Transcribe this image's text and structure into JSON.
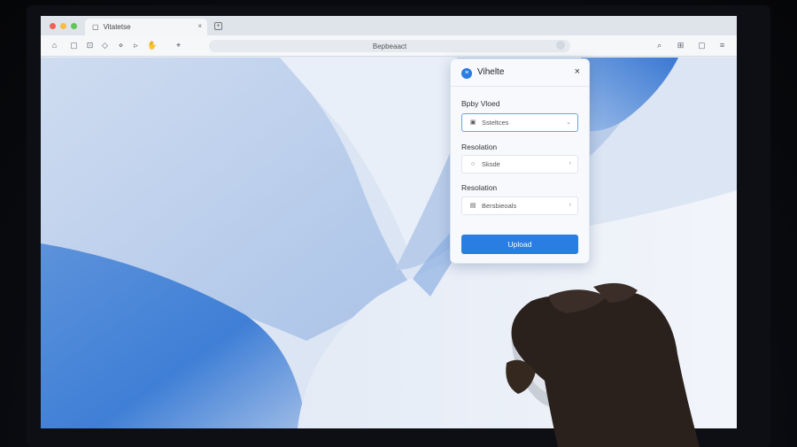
{
  "browser": {
    "tab_title": "Vitatetse",
    "tab_close": "×",
    "new_tab": "+",
    "address": "Bepbeaact",
    "address_icon": "Ǟ"
  },
  "toolbar_icons": [
    "home-icon",
    "page-icon",
    "bookmark-icon",
    "tag-icon",
    "sparkle-icon",
    "cursor-icon",
    "hand-icon",
    "pin-icon"
  ],
  "toolbar_right_icons": [
    "search-icon",
    "extensions-icon",
    "save-icon",
    "menu-icon"
  ],
  "dialog": {
    "title": "Vihelte",
    "close": "×",
    "section1_label": "Bpby Vloed",
    "field1_value": "Ssteltces",
    "section2_label": "Resolation",
    "field2_value": "Sksde",
    "section3_label": "Resolation",
    "field3_value": "Bersbieoals",
    "upload_label": "Upload"
  },
  "colors": {
    "accent": "#2a7de1",
    "wallpaper_blue": "#3f7fd6"
  }
}
